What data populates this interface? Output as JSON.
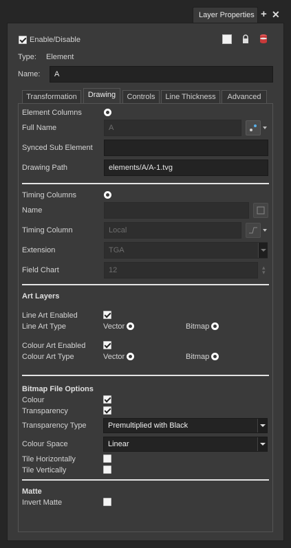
{
  "window": {
    "title": "Layer Properties",
    "add_icon": "plus-icon",
    "close_icon": "close-icon"
  },
  "header": {
    "enable_label": "Enable/Disable",
    "enable_checked": true,
    "type_label": "Type:",
    "type_value": "Element",
    "name_label": "Name:",
    "name_value": "A",
    "icons": [
      "color-swatch-icon",
      "lock-icon",
      "layer-stack-icon"
    ]
  },
  "tabs": [
    {
      "label": "Transformation",
      "active": false
    },
    {
      "label": "Drawing",
      "active": true
    },
    {
      "label": "Controls",
      "active": false
    },
    {
      "label": "Line Thickness",
      "active": false
    },
    {
      "label": "Advanced",
      "active": false
    }
  ],
  "drawing": {
    "element_columns_label": "Element Columns",
    "full_name_label": "Full Name",
    "full_name_value": "A",
    "synced_sub_element_label": "Synced Sub Element",
    "synced_sub_element_value": "",
    "drawing_path_label": "Drawing Path",
    "drawing_path_value": "elements/A/A-1.tvg",
    "timing_columns_label": "Timing Columns",
    "name_label": "Name",
    "name_value": "",
    "timing_column_label": "Timing Column",
    "timing_column_value": "Local",
    "extension_label": "Extension",
    "extension_value": "TGA",
    "field_chart_label": "Field Chart",
    "field_chart_value": "12"
  },
  "art_layers": {
    "heading": "Art Layers",
    "line_art_enabled_label": "Line Art Enabled",
    "line_art_enabled": true,
    "line_art_type_label": "Line Art Type",
    "vector_label": "Vector",
    "bitmap_label": "Bitmap",
    "colour_art_enabled_label": "Colour Art Enabled",
    "colour_art_enabled": true,
    "colour_art_type_label": "Colour Art Type",
    "vector_label_2": "Vector",
    "bitmap_label_2": "Bitmap"
  },
  "bitmap_options": {
    "heading": "Bitmap File Options",
    "colour_label": "Colour",
    "colour_checked": true,
    "transparency_label": "Transparency",
    "transparency_checked": true,
    "transparency_type_label": "Transparency Type",
    "transparency_type_value": "Premultiplied with Black",
    "colour_space_label": "Colour Space",
    "colour_space_value": "Linear",
    "tile_h_label": "Tile Horizontally",
    "tile_h_checked": false,
    "tile_v_label": "Tile Vertically",
    "tile_v_checked": false
  },
  "matte": {
    "heading": "Matte",
    "invert_matte_label": "Invert Matte",
    "invert_matte_checked": false
  }
}
